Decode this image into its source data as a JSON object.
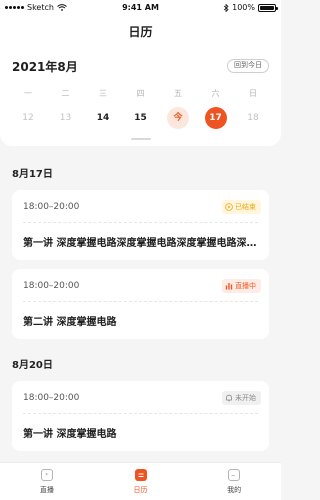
{
  "status": {
    "carrier": "Sketch",
    "time": "9:41 AM",
    "battery": "100%"
  },
  "nav": {
    "title": "日历"
  },
  "calendar": {
    "month": "2021年8月",
    "today_button": "回到今日",
    "weekdays": [
      "一",
      "二",
      "三",
      "四",
      "五",
      "六",
      "日"
    ],
    "dates": [
      "12",
      "13",
      "14",
      "15",
      "今",
      "17",
      "18"
    ]
  },
  "sections": [
    {
      "date": "8月17日"
    },
    {
      "date": "8月20日"
    }
  ],
  "cards": [
    {
      "time": "18:00–20:00",
      "status": "已结束",
      "title": "第一讲 深度掌握电路深度掌握电路深度掌握电路深度掌握电路"
    },
    {
      "time": "18:00–20:00",
      "status": "直播中",
      "title": "第二讲 深度掌握电路"
    },
    {
      "time": "18:00–20:00",
      "status": "未开始",
      "title": "第一讲 深度掌握电路"
    }
  ],
  "tabs": [
    {
      "label": "直播"
    },
    {
      "label": "日历"
    },
    {
      "label": "我的"
    }
  ],
  "colors": {
    "accent": "#ef5322",
    "ended": "#f2a613",
    "muted": "#8a8a8a"
  }
}
